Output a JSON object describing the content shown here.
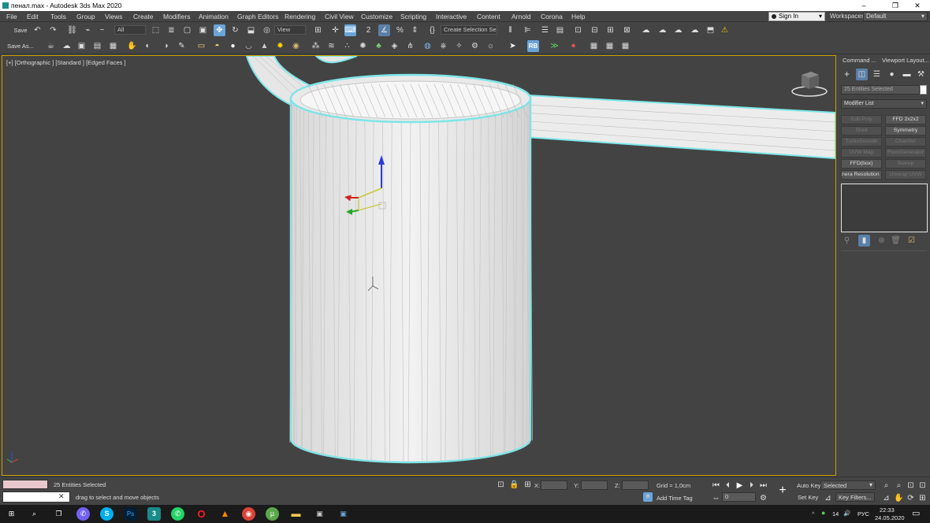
{
  "window": {
    "title": "пенал.max - Autodesk 3ds Max 2020",
    "minimize": "–",
    "restore": "❐",
    "close": "✕"
  },
  "menu": [
    "File",
    "Edit",
    "Tools",
    "Group",
    "Views",
    "Create",
    "Modifiers",
    "Animation",
    "Graph Editors",
    "Rendering",
    "Civil View",
    "Customize",
    "Scripting",
    "Interactive",
    "Content",
    "Arnold",
    "Corona",
    "Help"
  ],
  "account": {
    "sign_in": "Sign In",
    "workspaces_label": "Workspaces:",
    "workspace": "Default"
  },
  "toolbar": {
    "save": "Save",
    "save_as": "Save As...",
    "selection_filter": "All",
    "ref_coord": "View",
    "named_selection": "Create Selection Se"
  },
  "viewport": {
    "label": "[+] [Orthographic ] [Standard ] [Edged Faces ]"
  },
  "command_panel": {
    "tabs": [
      "Command ...",
      "Viewport Layout..."
    ],
    "selection_name": "25 Entities Selected",
    "modifier_list": "Modifier List",
    "modifiers": [
      {
        "label": "Edit Poly",
        "on": false
      },
      {
        "label": "FFD 2x2x2",
        "on": true
      },
      {
        "label": "Shell",
        "on": false
      },
      {
        "label": "Symmetry",
        "on": true
      },
      {
        "label": "TurboSmooth",
        "on": false
      },
      {
        "label": "Chamfer",
        "on": false
      },
      {
        "label": "UVW Map",
        "on": false
      },
      {
        "label": "FloorGenerator",
        "on": false
      },
      {
        "label": "FFD(box)",
        "on": true
      },
      {
        "label": "Sweep",
        "on": false
      },
      {
        "label": "nera Resolution N",
        "on": true
      },
      {
        "label": "Unwrap UVW",
        "on": false
      }
    ]
  },
  "status": {
    "selected": "25 Entities Selected",
    "prompt": "drag to select and move objects",
    "x_label": "X:",
    "y_label": "Y:",
    "z_label": "Z:",
    "grid": "Grid = 1,0cm",
    "add_time_tag": "Add Time Tag",
    "auto_key": "Auto Key",
    "set_key": "Set Key",
    "selected_dropdown": "Selected",
    "key_filters": "Key Filters...",
    "frame": "0"
  },
  "taskbar": {
    "lang": "РУС",
    "time": "22:33",
    "date": "24.05.2020",
    "temp": "14"
  },
  "colors": {
    "selection_outline": "#7fe5e8",
    "viewport_border": "#c8a000",
    "active_tool": "#6aa4d8"
  }
}
